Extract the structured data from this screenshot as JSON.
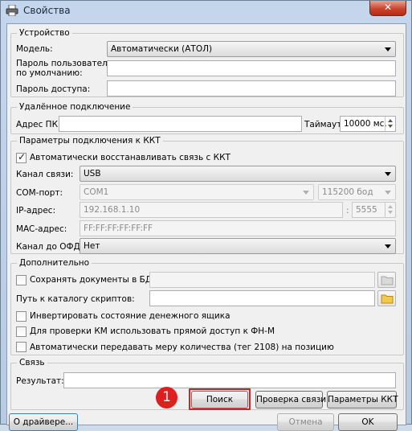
{
  "window": {
    "title": "Свойства",
    "close_glyph": "✕"
  },
  "device": {
    "group_title": "Устройство",
    "model_label": "Модель:",
    "model_value": "Автоматически (АТОЛ)",
    "user_password_label": "Пароль пользователя\nпо умолчанию:",
    "user_password_value": "",
    "access_password_label": "Пароль доступа:",
    "access_password_value": ""
  },
  "remote": {
    "group_title": "Удалённое подключение",
    "pc_address_label": "Адрес ПК:",
    "pc_address_value": "",
    "timeout_label": "Таймаут",
    "timeout_value": "10000 мс."
  },
  "connection": {
    "group_title": "Параметры подключения к ККТ",
    "auto_restore_label": "Автоматически восстанавливать связь с ККТ",
    "auto_restore_checked": true,
    "channel_label": "Канал связи:",
    "channel_value": "USB",
    "com_label": "COM-порт:",
    "com_value": "COM1",
    "baud_value": "115200 бод",
    "ip_label": "IP-адрес:",
    "ip_value": "192.168.1.10",
    "port_sep": ":",
    "port_value": "5555",
    "mac_label": "MAC-адрес:",
    "mac_value": "FF:FF:FF:FF:FF:FF",
    "ofd_label": "Канал до ОФД:",
    "ofd_value": "Нет"
  },
  "extra": {
    "group_title": "Дополнительно",
    "save_docs_label": "Сохранять документы в БД",
    "save_docs_checked": false,
    "save_docs_path": "",
    "scripts_label": "Путь к каталогу скриптов:",
    "scripts_path": "",
    "invert_drawer_label": "Инвертировать состояние денежного ящика",
    "invert_drawer_checked": false,
    "direct_access_label": "Для проверки КМ использовать прямой доступ к ФН-М",
    "direct_access_checked": false,
    "quantity_measure_label": "Автоматически передавать меру количества (тег 2108) на позицию",
    "quantity_measure_checked": false
  },
  "link": {
    "group_title": "Связь",
    "result_label": "Результат:",
    "result_value": "",
    "search_button": "Поиск",
    "check_button": "Проверка связи",
    "kkt_params_button": "Параметры ККТ",
    "annotation_number": "1"
  },
  "footer": {
    "about_button": "О драйвере...",
    "cancel_button": "Отмена",
    "ok_button": "OK"
  },
  "colors": {
    "annotation": "#e01e1e"
  }
}
